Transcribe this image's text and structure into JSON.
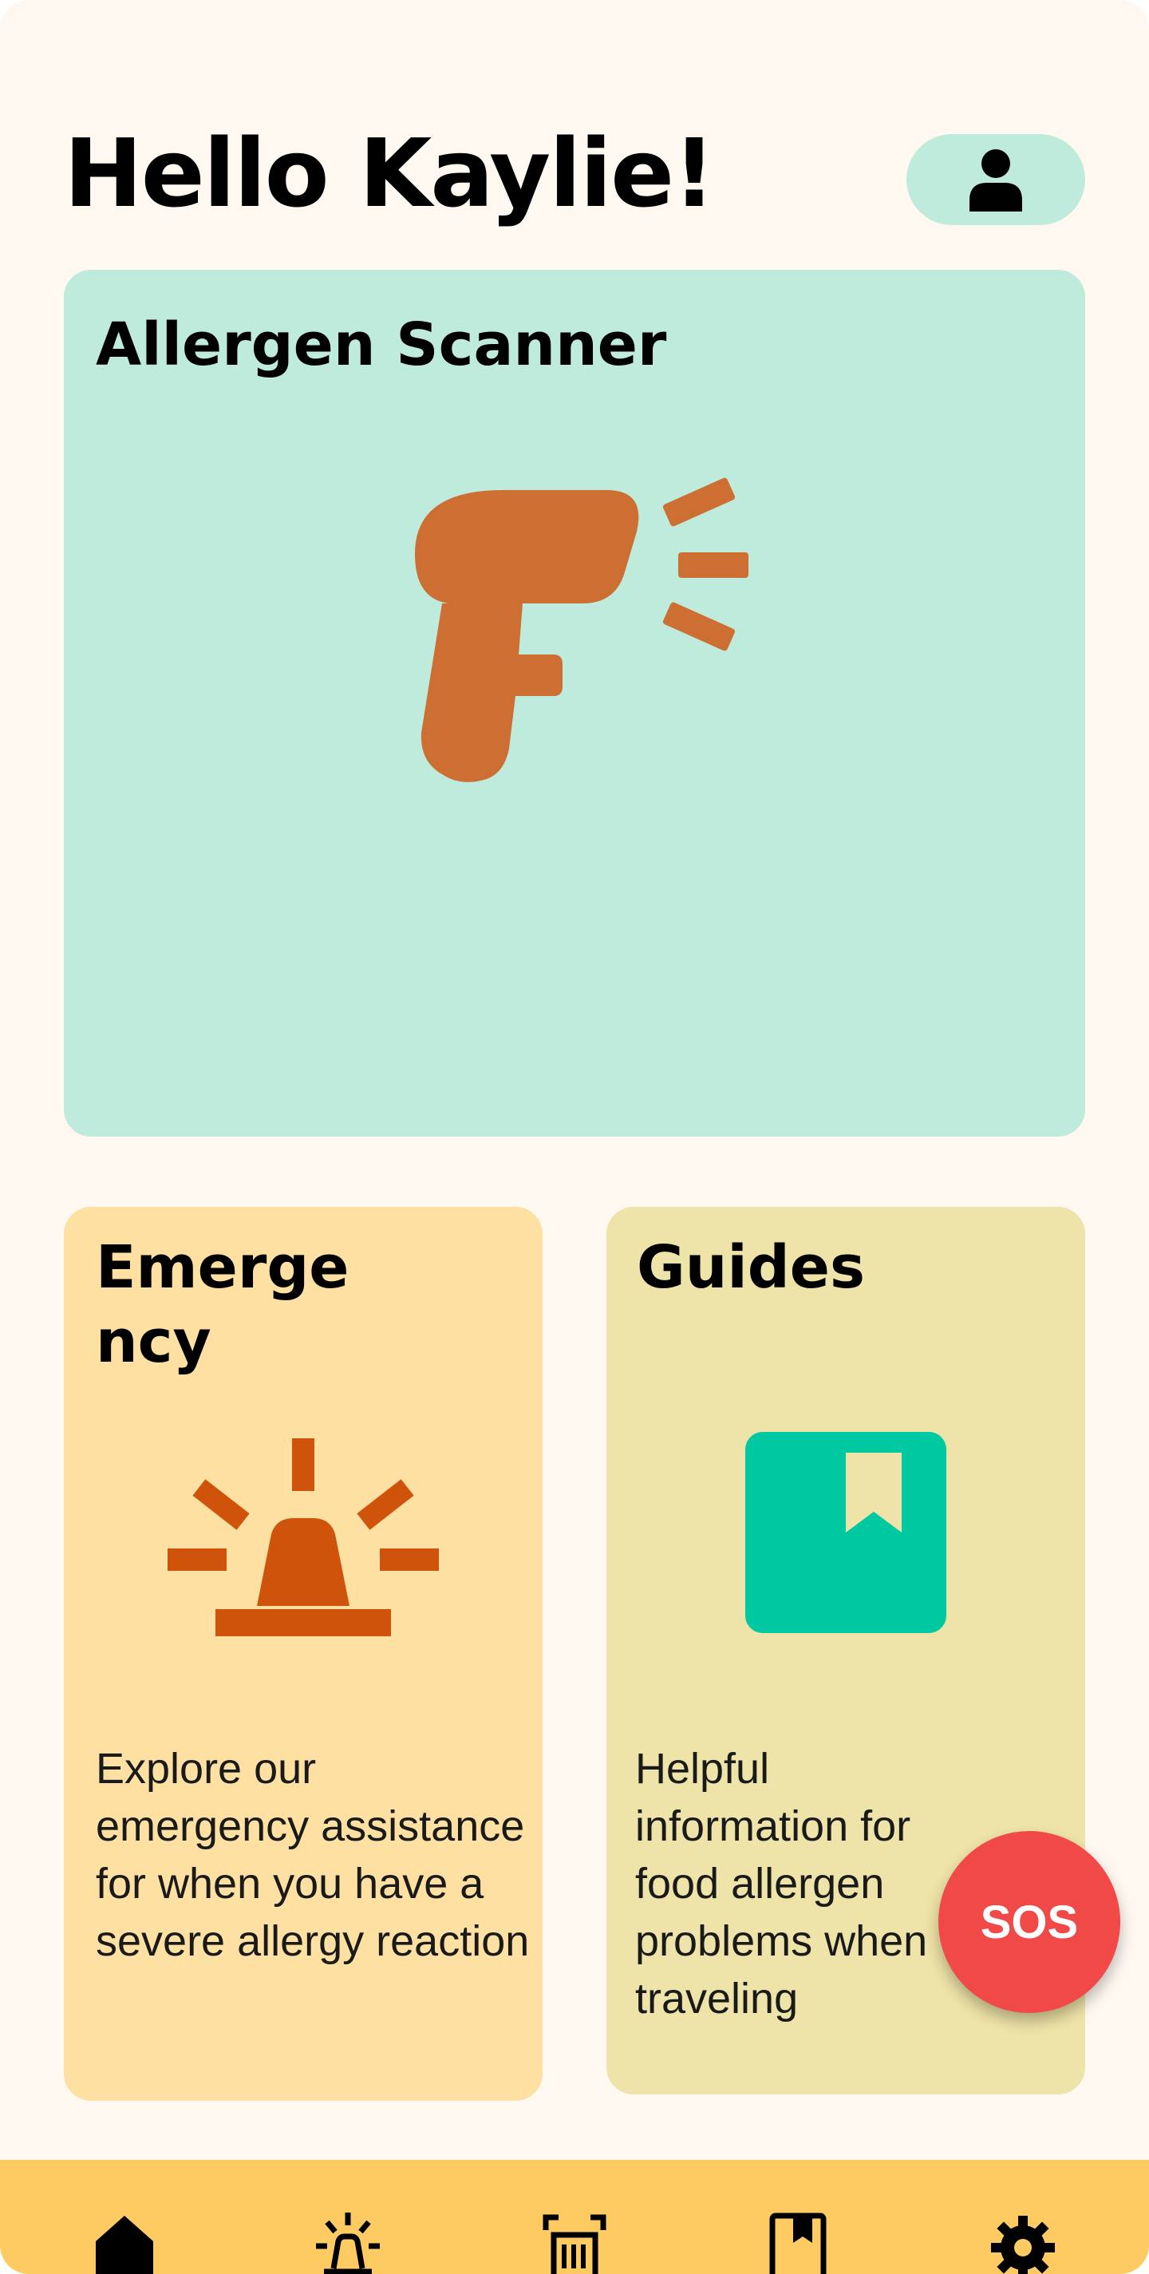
{
  "header": {
    "greeting": "Hello Kaylie!",
    "profile_icon": "user-icon"
  },
  "cards": {
    "scanner": {
      "title": "Allergen Scanner",
      "icon": "barcode-scanner-icon"
    },
    "emergency": {
      "title": "Emerge\nncy",
      "title_line1": "Emerge",
      "title_line2": "ncy",
      "description": "Explore our emergency assistance for when you have a severe allergy reaction",
      "icon": "siren-icon"
    },
    "guides": {
      "title": "Guides",
      "description": "Helpful information for food allergen problems when traveling",
      "icon": "book-icon"
    }
  },
  "sos": {
    "label": "SOS"
  },
  "nav": {
    "items": [
      {
        "name": "home",
        "icon": "home-icon"
      },
      {
        "name": "emergency",
        "icon": "siren-icon"
      },
      {
        "name": "scanner",
        "icon": "barcode-scan-icon"
      },
      {
        "name": "guides",
        "icon": "book-icon"
      },
      {
        "name": "settings",
        "icon": "gear-icon"
      }
    ]
  },
  "colors": {
    "background": "#FEF8F1",
    "mint": "#BFEBDC",
    "peach": "#FEE0A2",
    "khaki": "#EEE3A8",
    "scanner_orange": "#CD6F33",
    "siren_orange": "#D0530C",
    "teal": "#00C8A1",
    "sos_red": "#F14848",
    "nav_yellow": "#FECB63"
  }
}
